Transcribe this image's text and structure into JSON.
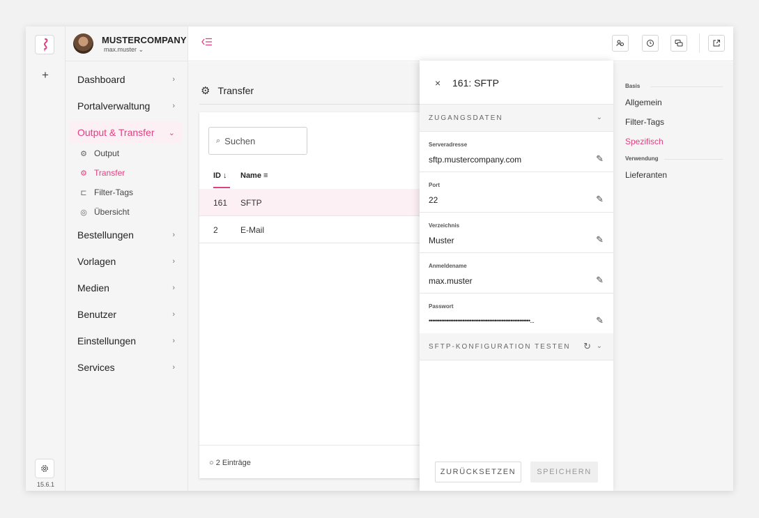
{
  "rail": {
    "add_label": "+",
    "version": "15.6.1"
  },
  "company": {
    "name": "MUSTERCOMPANY",
    "user": "max.muster ⌄"
  },
  "nav": {
    "items_top": [
      {
        "label": "Dashboard",
        "chevron": "›"
      },
      {
        "label": "Portalverwaltung",
        "chevron": "›"
      }
    ],
    "active_group": {
      "label": "Output & Transfer",
      "chevron": "⌄"
    },
    "sub_items": [
      {
        "label": "Output",
        "icon": "gear-icon",
        "glyph": "⚙"
      },
      {
        "label": "Transfer",
        "icon": "gear-icon",
        "glyph": "⚙"
      },
      {
        "label": "Filter-Tags",
        "icon": "tag-icon",
        "glyph": "⊏"
      },
      {
        "label": "Übersicht",
        "icon": "eye-icon",
        "glyph": "◎"
      }
    ],
    "items_bottom": [
      {
        "label": "Bestellungen",
        "chevron": "›"
      },
      {
        "label": "Vorlagen",
        "chevron": "›"
      },
      {
        "label": "Medien",
        "chevron": "›"
      },
      {
        "label": "Benutzer",
        "chevron": "›"
      },
      {
        "label": "Einstellungen",
        "chevron": "›"
      },
      {
        "label": "Services",
        "chevron": "›"
      }
    ]
  },
  "page": {
    "title": "Transfer"
  },
  "list": {
    "search_placeholder": "Suchen",
    "columns": {
      "id": "ID ↓",
      "name": "Name ≡"
    },
    "rows": [
      {
        "id": "161",
        "name": "SFTP"
      },
      {
        "id": "2",
        "name": "E-Mail"
      }
    ],
    "footer": "2 Einträge"
  },
  "panel": {
    "close": "×",
    "title": "161: SFTP",
    "section_access": "ZUGANGSDATEN",
    "fields": [
      {
        "label": "Serveradresse",
        "value": "sftp.mustercompany.com"
      },
      {
        "label": "Port",
        "value": "22"
      },
      {
        "label": "Verzeichnis",
        "value": "Muster"
      },
      {
        "label": "Anmeldename",
        "value": "max.muster"
      },
      {
        "label": "Passwort",
        "value": "•••••••••••••••••••••••••••••••••••••••••••••••••••••••••..."
      }
    ],
    "section_test": "SFTP-KONFIGURATION TESTEN",
    "reset_label": "ZURÜCKSETZEN",
    "save_label": "SPEICHERN"
  },
  "subnav": {
    "group1": "Basis",
    "items1": [
      "Allgemein",
      "Filter-Tags",
      "Spezifisch"
    ],
    "group2": "Verwendung",
    "items2": [
      "Lieferanten"
    ]
  },
  "colors": {
    "accent": "#e0407f",
    "background": "#f5f5f5"
  }
}
